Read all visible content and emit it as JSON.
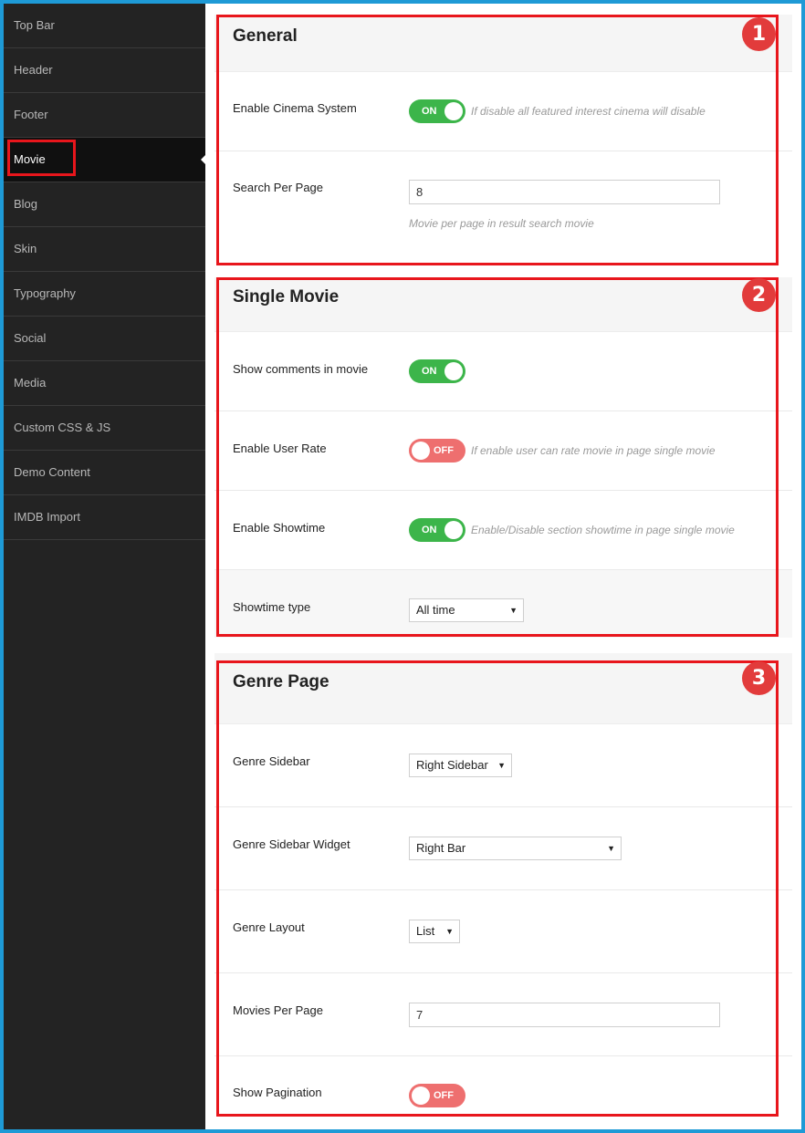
{
  "sidebar": {
    "items": [
      {
        "label": "Top Bar"
      },
      {
        "label": "Header"
      },
      {
        "label": "Footer"
      },
      {
        "label": "Movie"
      },
      {
        "label": "Blog"
      },
      {
        "label": "Skin"
      },
      {
        "label": "Typography"
      },
      {
        "label": "Social"
      },
      {
        "label": "Media"
      },
      {
        "label": "Custom CSS & JS"
      },
      {
        "label": "Demo Content"
      },
      {
        "label": "IMDB Import"
      }
    ],
    "active_index": 3
  },
  "sections": {
    "general": {
      "title": "General",
      "badge": "1",
      "enable_cinema": {
        "label": "Enable Cinema System",
        "state": "ON",
        "hint": "If disable all featured interest cinema will disable"
      },
      "search_per_page": {
        "label": "Search Per Page",
        "value": "8",
        "hint": "Movie per page in result search movie"
      }
    },
    "single_movie": {
      "title": "Single Movie",
      "badge": "2",
      "show_comments": {
        "label": "Show comments in movie",
        "state": "ON"
      },
      "user_rate": {
        "label": "Enable User Rate",
        "state": "OFF",
        "hint": "If enable user can rate movie in page single movie"
      },
      "showtime": {
        "label": "Enable Showtime",
        "state": "ON",
        "hint": "Enable/Disable section showtime in page single movie"
      },
      "showtime_type": {
        "label": "Showtime type",
        "value": "All time"
      }
    },
    "genre_page": {
      "title": "Genre Page",
      "badge": "3",
      "genre_sidebar": {
        "label": "Genre Sidebar",
        "value": "Right Sidebar"
      },
      "genre_sidebar_widget": {
        "label": "Genre Sidebar Widget",
        "value": "Right Bar"
      },
      "genre_layout": {
        "label": "Genre Layout",
        "value": "List"
      },
      "movies_per_page": {
        "label": "Movies Per Page",
        "value": "7"
      },
      "show_pagination": {
        "label": "Show Pagination",
        "state": "OFF"
      }
    }
  },
  "icons": {
    "dropdown": "▼"
  },
  "colors": {
    "toggle_on": "#3cb54a",
    "toggle_off": "#ee6f6f",
    "annotation_red": "#e8161c",
    "frame_blue": "#1e9ad6"
  }
}
